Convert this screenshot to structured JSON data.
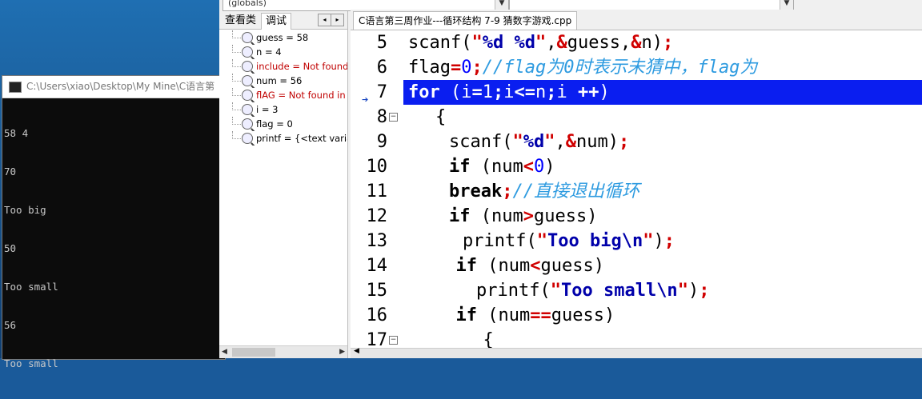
{
  "console": {
    "title": "C:\\Users\\xiao\\Desktop\\My Mine\\C语言第",
    "lines": [
      "58 4",
      "70",
      "Too big",
      "50",
      "Too small",
      "56",
      "Too small"
    ]
  },
  "ide": {
    "combo_left": "(globals)",
    "left_tabs": [
      "查看类",
      "调试"
    ],
    "watch": [
      {
        "text": "guess = 58",
        "error": false
      },
      {
        "text": "n = 4",
        "error": false
      },
      {
        "text": "include = Not found",
        "error": true
      },
      {
        "text": "num = 56",
        "error": false
      },
      {
        "text": "flAG = Not found in c",
        "error": true
      },
      {
        "text": "i = 3",
        "error": false
      },
      {
        "text": "flag = 0",
        "error": false
      },
      {
        "text": "printf = {<text variab",
        "error": false
      }
    ],
    "file_tab": "C语言第三周作业---循环结构 7-9 猜数字游戏.cpp",
    "code_lines": [
      {
        "n": "5",
        "text": "scanf(\"%d %d\",&guess,&n);"
      },
      {
        "n": "6",
        "text": "flag=0;//flag为0时表示未猜中，flag为"
      },
      {
        "n": "7",
        "text": "for (i=1;i<=n;i ++)"
      },
      {
        "n": "8",
        "text": "{"
      },
      {
        "n": "9",
        "text": "scanf(\"%d\",&num);"
      },
      {
        "n": "10",
        "text": "if (num<0)"
      },
      {
        "n": "11",
        "text": "break;//直接退出循环"
      },
      {
        "n": "12",
        "text": "if (num>guess)"
      },
      {
        "n": "13",
        "text": "printf(\"Too big\\n\");"
      },
      {
        "n": "14",
        "text": "if (num<guess)"
      },
      {
        "n": "15",
        "text": "printf(\"Too small\\n\");"
      },
      {
        "n": "16",
        "text": "if (num==guess)"
      },
      {
        "n": "17",
        "text": "{"
      }
    ]
  }
}
